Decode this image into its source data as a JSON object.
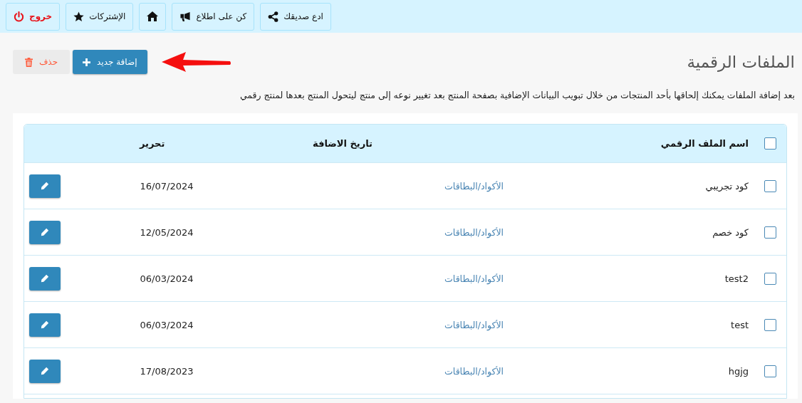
{
  "top_nav": [
    {
      "label": "ادع صديقك",
      "kind": "share"
    },
    {
      "label": "كن على اطلاع",
      "kind": "announce"
    },
    {
      "kind": "home"
    },
    {
      "label": "الإشتركات",
      "kind": "star"
    },
    {
      "label": "خروج",
      "kind": "logout"
    }
  ],
  "page_title": "الملفات الرقمية",
  "actions": [
    {
      "label": "إضافة جديد",
      "kind": "add"
    },
    {
      "label": "حذف",
      "kind": "delete"
    }
  ],
  "annotation_arrow": true,
  "description": "بعد إضافة الملفات يمكنك إلحاقها بأحد المنتجات من خلال تبويب البيانات الإضافية بصفحة المنتج بعد تغيير نوعه إلى منتج ليتحول المنتج بعدها لمنتج رقمي",
  "table": {
    "select_all": {
      "checked": false
    },
    "columns": [
      {
        "label": "اسم الملف الرقمي"
      },
      {
        "label": "تاريخ الاضافة"
      },
      {
        "label": "تحرير"
      }
    ],
    "rows": [
      {
        "checked": false,
        "name": "كود تجريبي",
        "category": "الأكواد/البطاقات",
        "date": "16/07/2024"
      },
      {
        "checked": false,
        "name": "كود خصم",
        "category": "الأكواد/البطاقات",
        "date": "12/05/2024"
      },
      {
        "checked": false,
        "name": "test2",
        "category": "الأكواد/البطاقات",
        "date": "06/03/2024"
      },
      {
        "checked": false,
        "name": "test",
        "category": "الأكواد/البطاقات",
        "date": "06/03/2024"
      },
      {
        "checked": false,
        "name": "hgjg",
        "category": "الأكواد/البطاقات",
        "date": "17/08/2023"
      }
    ]
  }
}
